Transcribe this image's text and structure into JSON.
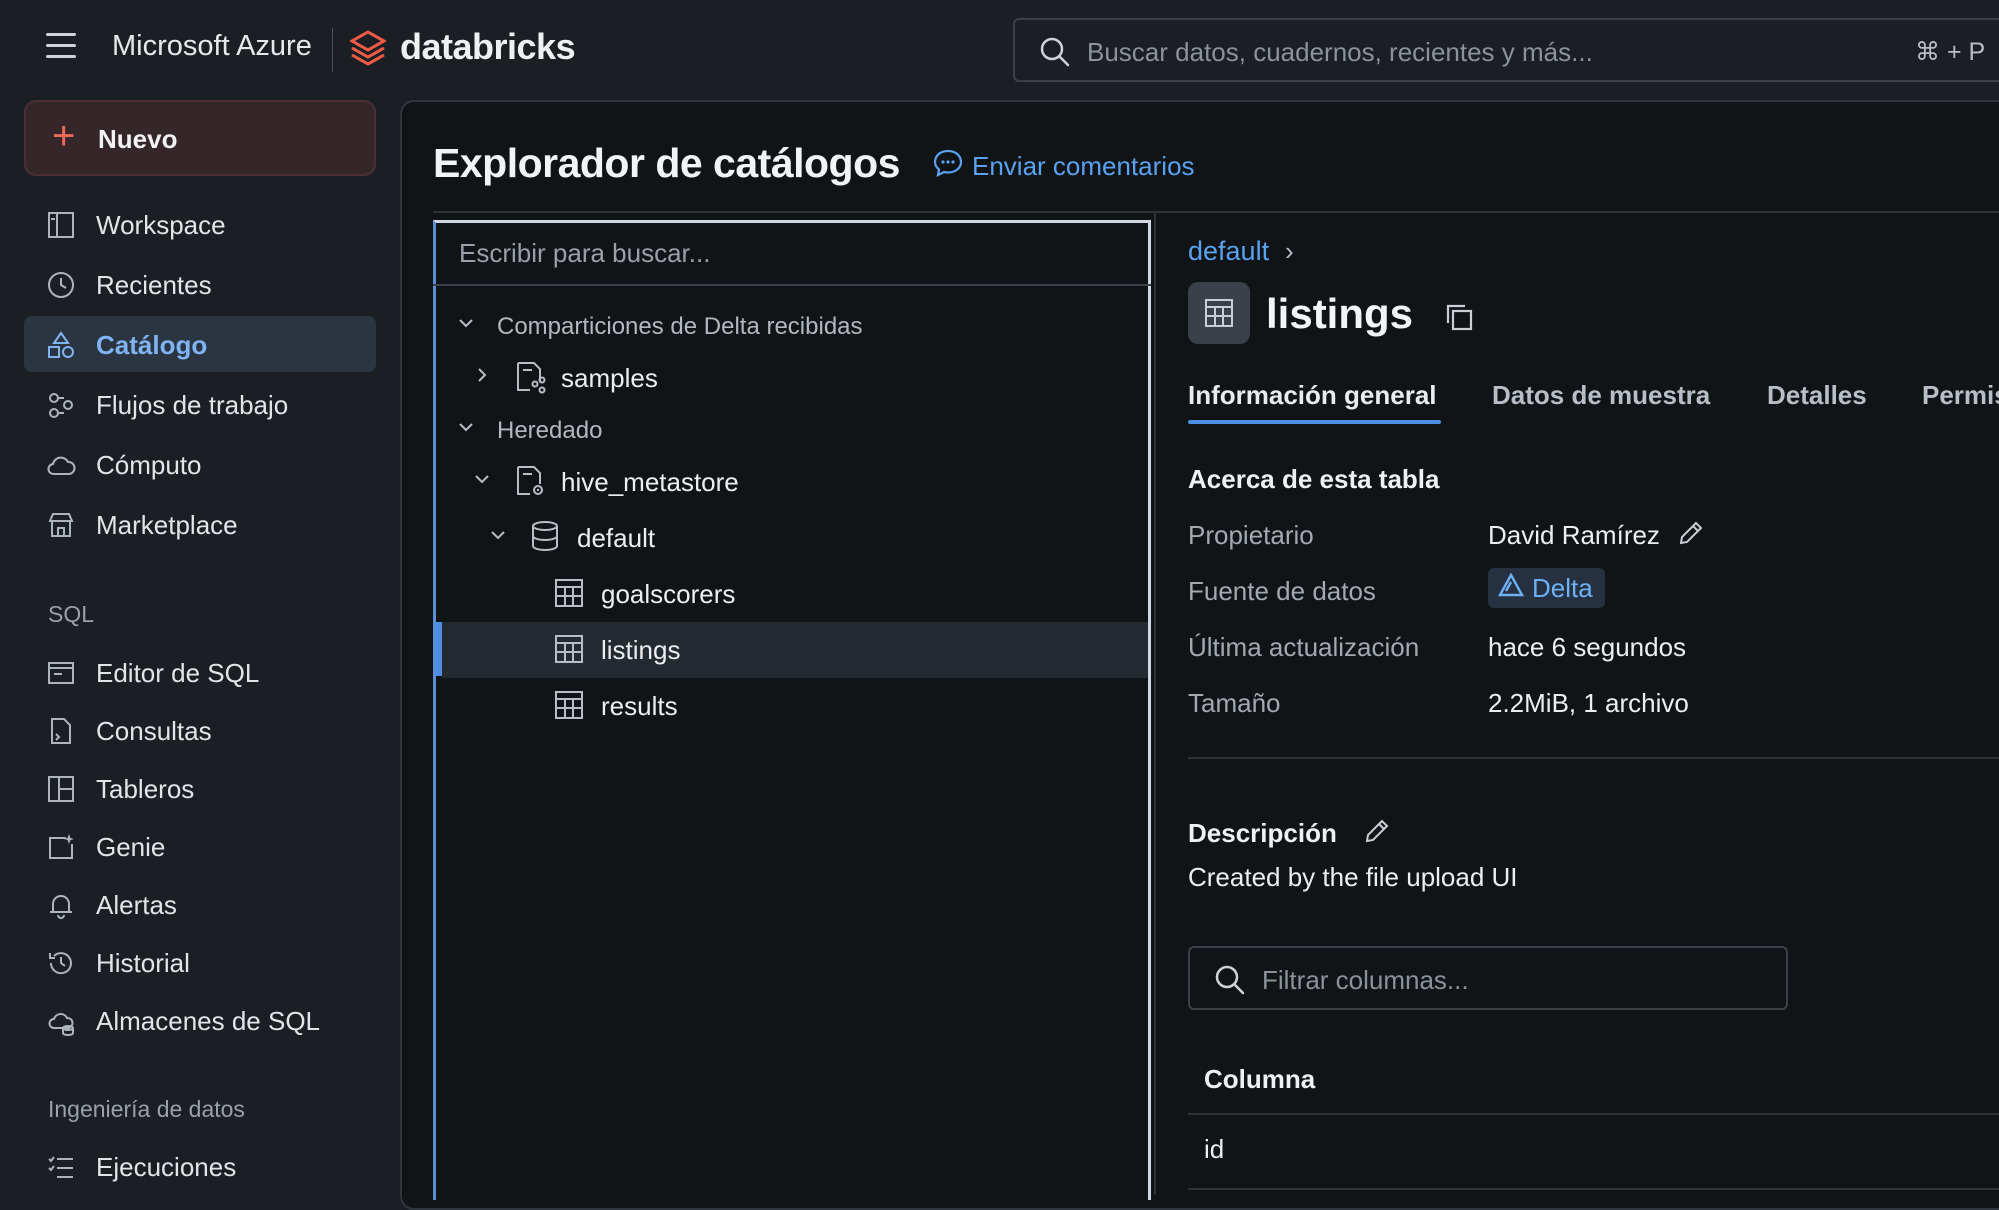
{
  "topbar": {
    "cloud_label": "Microsoft Azure",
    "brand": "databricks",
    "search_placeholder": "Buscar datos, cuadernos, recientes y más...",
    "search_shortcut": "⌘ + P"
  },
  "sidebar": {
    "new_label": "Nuevo",
    "items": [
      {
        "label": "Workspace",
        "icon": "workspace-icon"
      },
      {
        "label": "Recientes",
        "icon": "clock-icon"
      },
      {
        "label": "Catálogo",
        "icon": "catalog-icon",
        "active": true
      },
      {
        "label": "Flujos de trabajo",
        "icon": "workflows-icon"
      },
      {
        "label": "Cómputo",
        "icon": "cloud-icon"
      },
      {
        "label": "Marketplace",
        "icon": "store-icon"
      }
    ],
    "sql_section": "SQL",
    "sql_items": [
      {
        "label": "Editor de SQL",
        "icon": "sql-editor-icon"
      },
      {
        "label": "Consultas",
        "icon": "query-icon"
      },
      {
        "label": "Tableros",
        "icon": "dashboard-icon"
      },
      {
        "label": "Genie",
        "icon": "genie-icon"
      },
      {
        "label": "Alertas",
        "icon": "bell-icon"
      },
      {
        "label": "Historial",
        "icon": "history-icon"
      },
      {
        "label": "Almacenes de SQL",
        "icon": "warehouse-icon"
      }
    ],
    "de_section": "Ingeniería de datos",
    "de_items": [
      {
        "label": "Ejecuciones",
        "icon": "runs-icon"
      }
    ]
  },
  "main": {
    "title": "Explorador de catálogos",
    "feedback": "Enviar comentarios"
  },
  "tree": {
    "search_placeholder": "Escribir para buscar...",
    "group_delta": "Comparticiones de Delta recibidas",
    "samples": "samples",
    "group_legacy": "Heredado",
    "hive": "hive_metastore",
    "schema": "default",
    "tables": [
      "goalscorers",
      "listings",
      "results"
    ]
  },
  "detail": {
    "breadcrumb": "default",
    "breadcrumb_sep": "›",
    "table_name": "listings",
    "tabs": [
      "Información general",
      "Datos de muestra",
      "Detalles",
      "Permis"
    ],
    "about_title": "Acerca de esta tabla",
    "props": {
      "owner_key": "Propietario",
      "owner_val": "David Ramírez",
      "source_key": "Fuente de datos",
      "source_val": "Delta",
      "updated_key": "Última actualización",
      "updated_val": "hace 6 segundos",
      "size_key": "Tamaño",
      "size_val": "2.2MiB, 1 archivo"
    },
    "description_title": "Descripción",
    "description_text": "Created by the file upload UI",
    "filter_placeholder": "Filtrar columnas...",
    "column_header": "Columna",
    "columns": [
      "id"
    ]
  }
}
